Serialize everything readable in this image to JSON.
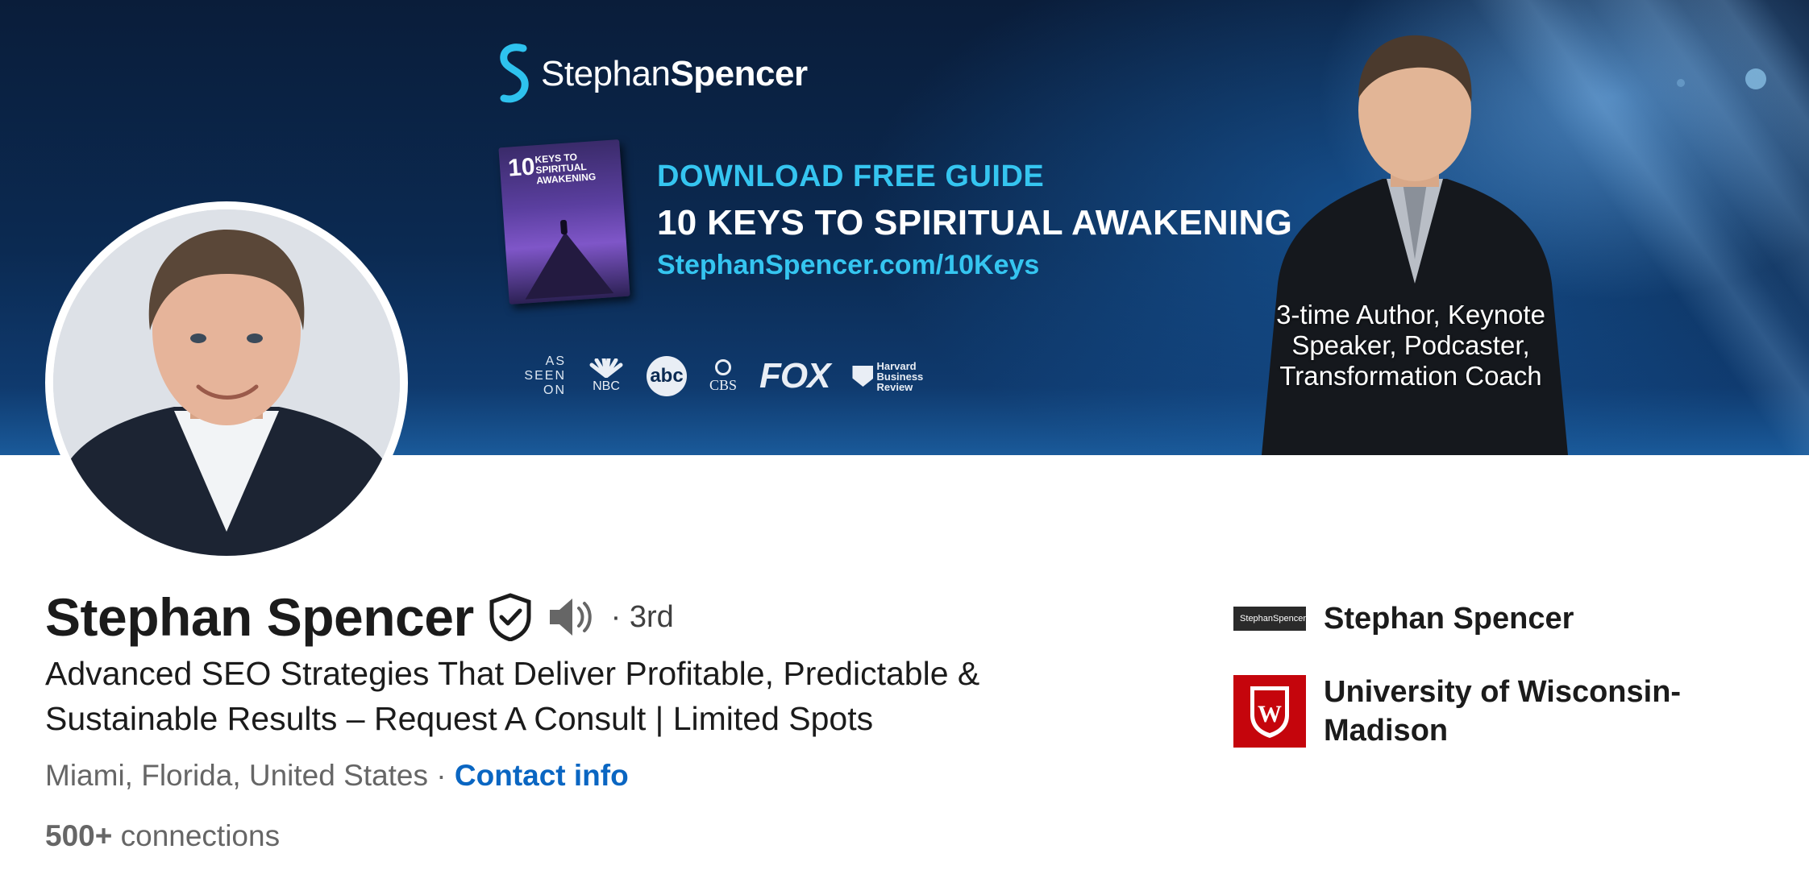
{
  "banner": {
    "brand_first": "Stephan",
    "brand_last": "Spencer",
    "book_number": "10",
    "book_title": "KEYS TO SPIRITUAL AWAKENING",
    "cta_line1": "DOWNLOAD FREE GUIDE",
    "cta_line2": "10 KEYS TO SPIRITUAL AWAKENING",
    "cta_url": "StephanSpencer.com/10Keys",
    "as_seen_on": "AS SEEN ON",
    "media_logos": [
      "NBC",
      "abc",
      "CBS",
      "FOX",
      "Harvard Business Review"
    ],
    "tagline": "3-time Author, Keynote Speaker, Podcaster, Transformation Coach"
  },
  "profile": {
    "name": "Stephan Spencer",
    "degree": "· 3rd",
    "headline": "Advanced SEO Strategies That Deliver Profitable, Predictable & Sustainable Results – Request A Consult | Limited Spots",
    "location": "Miami, Florida, United States",
    "separator": " · ",
    "contact_info": "Contact info",
    "connections_count": "500+",
    "connections_label": " connections"
  },
  "side": {
    "items": [
      {
        "label": "Stephan Spencer",
        "logo": "stephan-spencer-logo"
      },
      {
        "label": "University of Wisconsin-Madison",
        "logo": "uw-madison-crest"
      }
    ],
    "logo_text": "StephanSpencer"
  },
  "colors": {
    "link": "#0a66c2",
    "banner_accent": "#35c5f0",
    "uw_red": "#c5050c"
  }
}
